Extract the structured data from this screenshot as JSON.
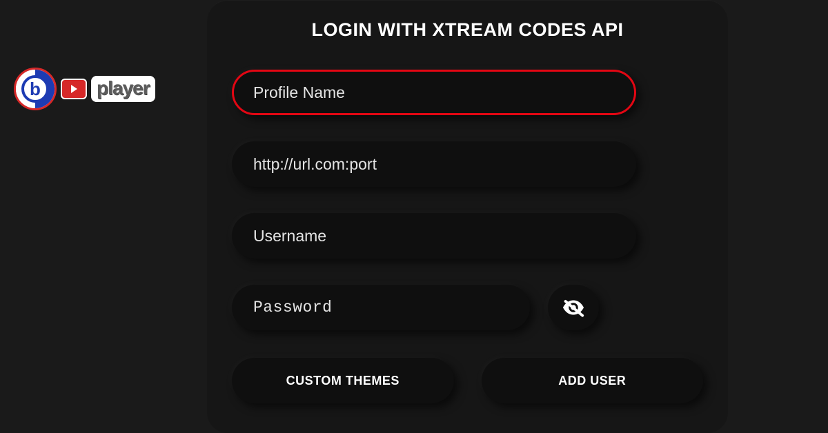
{
  "logo": {
    "brand_letter": "b",
    "brand_text": "player"
  },
  "panel": {
    "title": "LOGIN WITH XTREAM CODES API",
    "fields": {
      "profile": {
        "placeholder": "Profile Name",
        "value": "",
        "focused": true
      },
      "url": {
        "placeholder": "http://url.com:port",
        "value": ""
      },
      "username": {
        "placeholder": "Username",
        "value": ""
      },
      "password": {
        "placeholder": "Password",
        "value": "",
        "visible": false
      }
    },
    "buttons": {
      "themes": "CUSTOM THEMES",
      "add_user": "ADD USER"
    },
    "icons": {
      "toggle_visibility": "eye-off-icon"
    },
    "colors": {
      "accent": "#e30613",
      "bg": "#1a1a1a",
      "panel": "#161616",
      "field": "#0f0f0f"
    }
  }
}
